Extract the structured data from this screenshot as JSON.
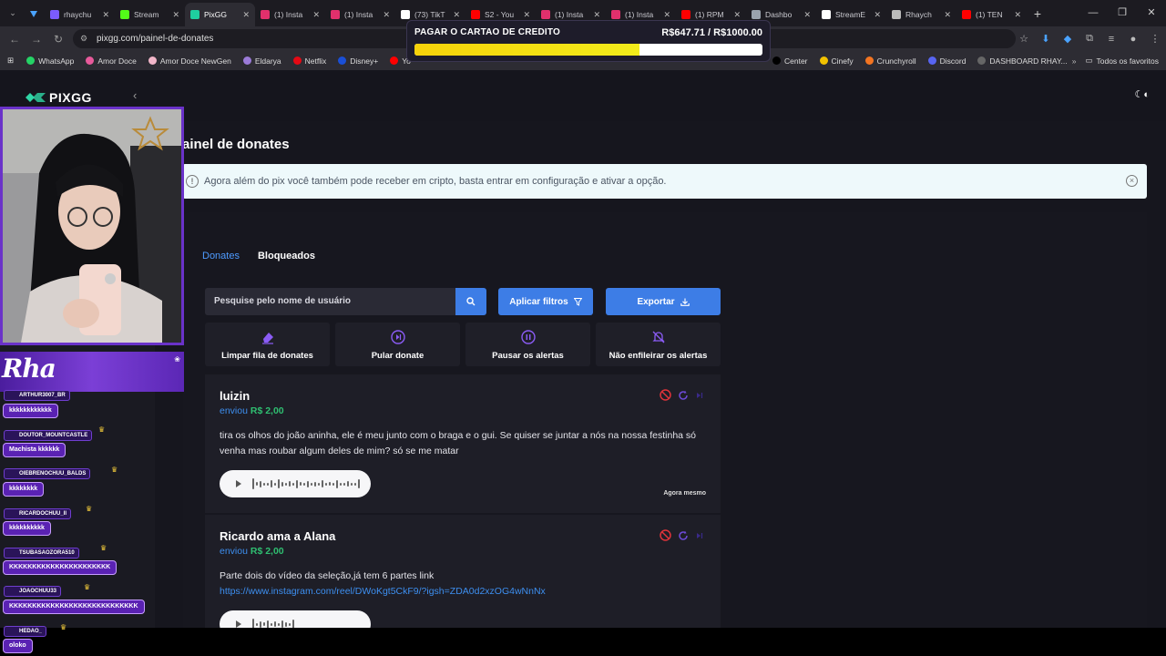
{
  "browser": {
    "tabs": [
      {
        "title": "rhaychu",
        "color": "#7b5cff",
        "active": false
      },
      {
        "title": "Stream",
        "color": "#53fc18",
        "active": false
      },
      {
        "title": "PixGG",
        "color": "#1fcfa0",
        "active": true
      },
      {
        "title": "(1) Insta",
        "color": "#e1306c",
        "active": false
      },
      {
        "title": "(1) Insta",
        "color": "#e1306c",
        "active": false
      },
      {
        "title": "(73) TikT",
        "color": "#ffffff",
        "active": false
      },
      {
        "title": "S2 - You",
        "color": "#ff0000",
        "active": false
      },
      {
        "title": "(1) Insta",
        "color": "#e1306c",
        "active": false
      },
      {
        "title": "(1) Insta",
        "color": "#e1306c",
        "active": false
      },
      {
        "title": "(1) RPM",
        "color": "#ff0000",
        "active": false
      },
      {
        "title": "Dashbo",
        "color": "#9aa3ad",
        "active": false
      },
      {
        "title": "StreamE",
        "color": "#ffffff",
        "active": false
      },
      {
        "title": "Rhaych",
        "color": "#bbbbbb",
        "active": false
      },
      {
        "title": "(1) TEN",
        "color": "#ff0000",
        "active": false
      }
    ],
    "url": "pixgg.com/painel-de-donates",
    "bookmarks": [
      {
        "label": "WhatsApp",
        "color": "#25d366"
      },
      {
        "label": "Amor Doce",
        "color": "#e85a9b"
      },
      {
        "label": "Amor Doce NewGen",
        "color": "#f2b6c9"
      },
      {
        "label": "Eldarya",
        "color": "#9b7bd8"
      },
      {
        "label": "Netflix",
        "color": "#e50914"
      },
      {
        "label": "Disney+",
        "color": "#1a4fd6"
      },
      {
        "label": "Yo",
        "color": "#ff0000"
      }
    ],
    "bookmarks_right": [
      {
        "label": "Center",
        "color": "#000000"
      },
      {
        "label": "Cinefy",
        "color": "#f2c200"
      },
      {
        "label": "Crunchyroll",
        "color": "#f47521"
      },
      {
        "label": "Discord",
        "color": "#5865f2"
      },
      {
        "label": "DASHBOARD RHAY...",
        "color": "#666666"
      }
    ],
    "all_bookmarks": "Todos os favoritos"
  },
  "goal": {
    "label": "PAGAR O CARTAO DE CREDITO",
    "amount_text": "R$647.71 / R$1000.00",
    "progress": 0.6477
  },
  "app": {
    "logo": "PIXGG",
    "page_title": "ainel de donates",
    "info_text": "Agora além do pix você também pode receber em cripto, basta entrar em configuração e ativar a opção.",
    "tabs": [
      {
        "label": "Donates"
      },
      {
        "label": "Bloqueados"
      }
    ],
    "search_placeholder": "Pesquise pelo nome de usuário",
    "filters_label": "Aplicar filtros",
    "export_label": "Exportar",
    "actions": [
      {
        "label": "Limpar fila de donates",
        "icon": "eraser-icon"
      },
      {
        "label": "Pular donate",
        "icon": "skip-icon"
      },
      {
        "label": "Pausar os alertas",
        "icon": "pause-icon"
      },
      {
        "label": "Não enfileirar os alertas",
        "icon": "bell-off-icon"
      }
    ],
    "donations": [
      {
        "name": "luizin",
        "sent_prefix": "enviou",
        "amount": "R$ 2,00",
        "message": "tira os olhos do joão aninha, ele é meu junto com o braga e o gui. Se quiser se juntar a nós na nossa festinha só venha mas roubar algum deles de mim? só se me matar",
        "time": "Agora mesmo"
      },
      {
        "name": "Ricardo ama a Alana",
        "sent_prefix": "enviou",
        "amount": "R$ 2,00",
        "message": "Parte dois do vídeo da seleção,já tem 6 partes link",
        "link": "https://www.instagram.com/reel/DWoKgt5CkF9/?igsh=ZDA0d2xzOG4wNnNx"
      }
    ]
  },
  "stream": {
    "banner": "Rha",
    "chat": [
      {
        "user": "ARTHUR3007_BR",
        "msg": "kkkkkkkkkkkk"
      },
      {
        "user": "DOUTOR_MOUNTCASTLE",
        "msg": "Machista kkkkkk"
      },
      {
        "user": "OIEBRENOCHUU_BALDS",
        "msg": "kkkkkkkk"
      },
      {
        "user": "RICARDOCHUU_II",
        "msg": "kkkkkkkkkk"
      },
      {
        "user": "TSUBASAOZORA510",
        "msg": "KKKKKKKKKKKKKKKKKKKKKK"
      },
      {
        "user": "JOAOCHUU33",
        "msg": "KKKKKKKKKKKKKKKKKKKKKKKKKKKK"
      },
      {
        "user": "HEDAO_",
        "msg": "oloko"
      }
    ]
  }
}
